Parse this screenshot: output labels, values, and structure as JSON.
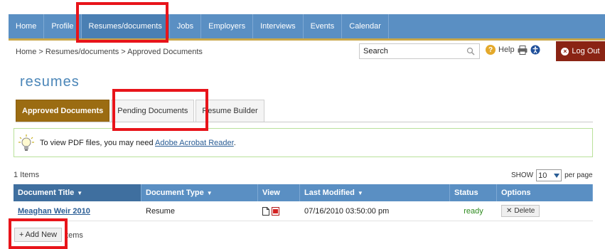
{
  "nav": {
    "items": [
      {
        "label": "Home",
        "width": 37
      },
      {
        "label": "Profile",
        "width": 49
      },
      {
        "label": "Resumes/documents",
        "width": 123
      },
      {
        "label": "Jobs",
        "width": 40
      },
      {
        "label": "Employers",
        "width": 64
      },
      {
        "label": "Interviews",
        "width": 67
      },
      {
        "label": "Events",
        "width": 51
      },
      {
        "label": "Calendar",
        "width": 56
      }
    ]
  },
  "breadcrumb": "Home > Resumes/documents > Approved Documents",
  "search": {
    "placeholder": "Search"
  },
  "help_label": "Help",
  "logout_label": "Log Out",
  "page_title": "resumes",
  "tabs": [
    {
      "label": "Approved Documents"
    },
    {
      "label": "Pending Documents"
    },
    {
      "label": "Resume Builder"
    }
  ],
  "notice": {
    "text": "To view PDF files, you may need ",
    "link": "Adobe Acrobat Reader",
    "suffix": "."
  },
  "items_count": "1 Items",
  "pager": {
    "show_label": "SHOW",
    "per_page_value": "10",
    "per_page_label": "per page"
  },
  "table": {
    "headers": [
      "Document Title",
      "Document Type",
      "View",
      "Last Modified",
      "Status",
      "Options"
    ],
    "rows": [
      {
        "title": "Meaghan Weir 2010",
        "type": "Resume",
        "modified": "07/16/2010 03:50:00 pm",
        "status": "ready",
        "option": "Delete"
      }
    ]
  },
  "add_new_label": "Add New",
  "bottom_items": "Items",
  "colors": {
    "nav": "#5a8fc3",
    "active_tab": "#9b6c12",
    "logout": "#8a2414",
    "highlight": "#e8141a",
    "status_ready": "#2e8b1f"
  }
}
